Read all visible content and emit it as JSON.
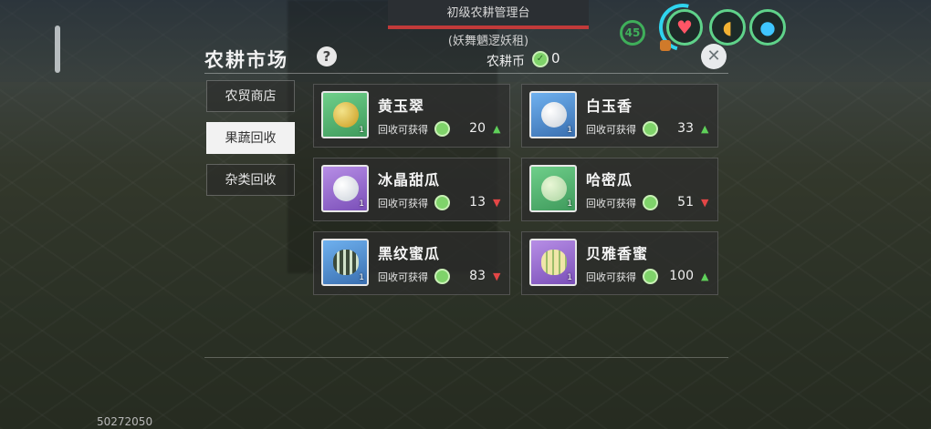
{
  "hud": {
    "banner_title": "初级农耕管理台",
    "subtitle": "(妖舞魉逻妖租)",
    "compass_label": "45",
    "icons": {
      "heart": "heart-icon",
      "food": "food-icon",
      "water": "water-drop-icon"
    }
  },
  "panel": {
    "title": "农耕市场",
    "help": "?",
    "currency_label": "农耕币",
    "currency_value": "0",
    "close": "✕"
  },
  "tabs": [
    {
      "label": "农贸商店",
      "active": false
    },
    {
      "label": "果蔬回收",
      "active": true
    },
    {
      "label": "杂类回收",
      "active": false
    }
  ],
  "items": [
    {
      "name": "黄玉翠",
      "recv_label": "回收可获得",
      "value": "20",
      "trend": "up",
      "qty": "1"
    },
    {
      "name": "白玉香",
      "recv_label": "回收可获得",
      "value": "33",
      "trend": "up",
      "qty": "1"
    },
    {
      "name": "冰晶甜瓜",
      "recv_label": "回收可获得",
      "value": "13",
      "trend": "down",
      "qty": "1"
    },
    {
      "name": "哈密瓜",
      "recv_label": "回收可获得",
      "value": "51",
      "trend": "down",
      "qty": "1"
    },
    {
      "name": "黑纹蜜瓜",
      "recv_label": "回收可获得",
      "value": "83",
      "trend": "down",
      "qty": "1"
    },
    {
      "name": "贝雅香蜜",
      "recv_label": "回收可获得",
      "value": "100",
      "trend": "up",
      "qty": "1"
    }
  ],
  "arrows": {
    "up": "▲",
    "down": "▼"
  },
  "footer": {
    "build_id": "50272050"
  }
}
